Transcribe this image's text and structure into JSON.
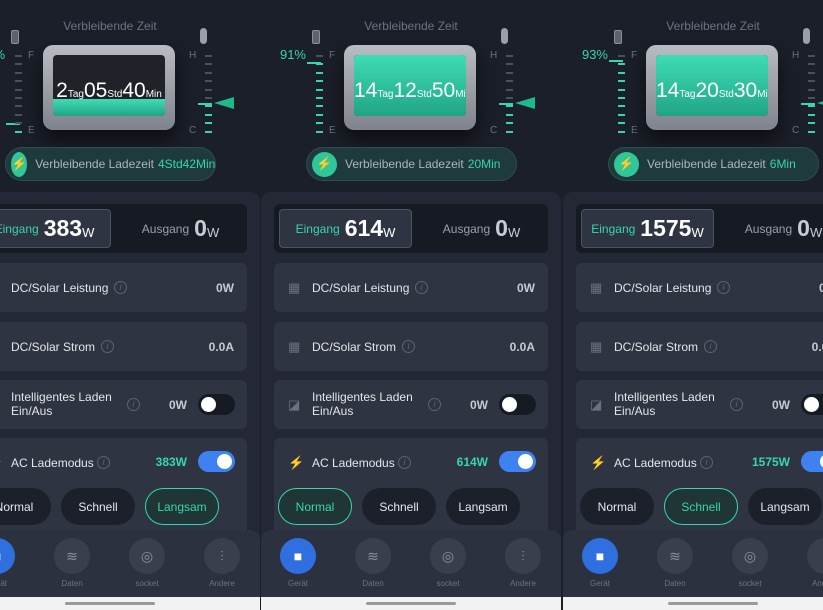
{
  "common": {
    "remaining_time_title": "Verbleibende Zeit",
    "gauge_full": "F",
    "gauge_empty": "E",
    "temp_high": "H",
    "temp_cold": "C",
    "charge_label": "Verbleibende Ladezeit",
    "input_label": "Eingang",
    "output_label": "Ausgang",
    "unit_w": "W",
    "output_value": "0",
    "rows": {
      "dc_power": "DC/Solar Leistung",
      "dc_power_value": "0W",
      "dc_current": "DC/Solar Strom",
      "dc_current_value": "0.0A",
      "smart_line1": "Intelligentes Laden",
      "smart_line2": "Ein/Aus",
      "smart_value": "0W",
      "ac_mode": "AC Lademodus"
    },
    "modes": [
      "Normal",
      "Schnell",
      "Langsam"
    ],
    "units": {
      "day": "Tag",
      "hour": "Std",
      "min": "Min"
    },
    "nav": [
      "Gerät",
      "Daten",
      "socket",
      "Andere"
    ],
    "accent": "#35d6ad"
  },
  "panels": [
    {
      "percent": "%",
      "battery_level": 0.1,
      "days": "2",
      "hours": "05",
      "minutes": "40",
      "charge_remaining": "4Std42Min",
      "input_value": "383",
      "ac_value": "383W",
      "selected_mode": 2,
      "smart_on": false,
      "ac_on": true
    },
    {
      "percent": "91%",
      "battery_level": 0.91,
      "days": "14",
      "hours": "12",
      "minutes": "50",
      "charge_remaining": "20Min",
      "input_value": "614",
      "ac_value": "614W",
      "selected_mode": 0,
      "smart_on": false,
      "ac_on": true
    },
    {
      "percent": "93%",
      "battery_level": 0.93,
      "days": "14",
      "hours": "20",
      "minutes": "30",
      "charge_remaining": "6Min",
      "input_value": "1575",
      "ac_value": "1575W",
      "selected_mode": 1,
      "smart_on": false,
      "ac_on": true
    }
  ]
}
